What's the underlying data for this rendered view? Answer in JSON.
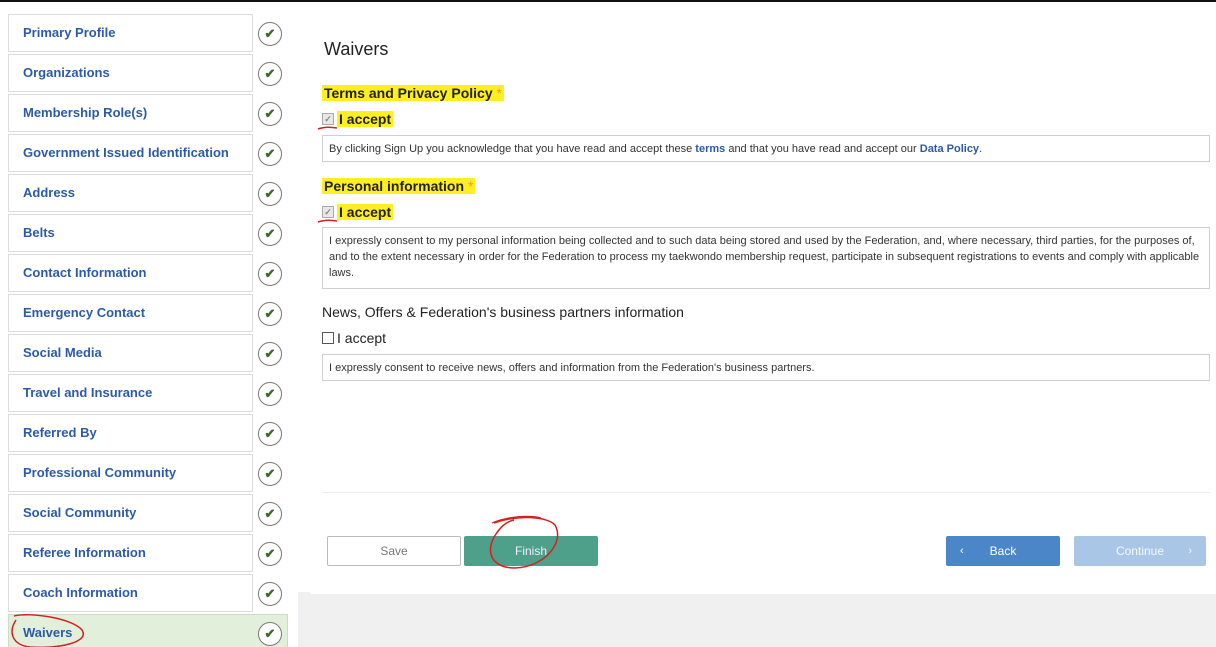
{
  "sidebar": {
    "items": [
      {
        "label": "Primary Profile"
      },
      {
        "label": "Organizations"
      },
      {
        "label": "Membership Role(s)"
      },
      {
        "label": "Government Issued Identification"
      },
      {
        "label": "Address"
      },
      {
        "label": "Belts"
      },
      {
        "label": "Contact Information"
      },
      {
        "label": "Emergency Contact"
      },
      {
        "label": "Social Media"
      },
      {
        "label": "Travel and Insurance"
      },
      {
        "label": "Referred By"
      },
      {
        "label": "Professional Community"
      },
      {
        "label": "Social Community"
      },
      {
        "label": "Referee Information"
      },
      {
        "label": "Coach Information"
      },
      {
        "label": "Waivers"
      }
    ],
    "check_glyph": "✔",
    "active_item": "Waivers"
  },
  "main": {
    "title": "Waivers",
    "sections": [
      {
        "title": "Terms and Privacy Policy",
        "required_mark": "*",
        "accept_label": "I accept",
        "checked": true,
        "text_before": "By clicking Sign Up you acknowledge that you have read and accept these ",
        "link1": "terms",
        "text_middle": " and that you have read and accept our ",
        "link2": "Data Policy",
        "text_after": "."
      },
      {
        "title": "Personal information",
        "required_mark": "*",
        "accept_label": "I accept",
        "checked": true,
        "text": "I expressly consent to my personal information being collected and to such data being stored and used by the Federation, and, where necessary, third parties, for the purposes of, and to the extent necessary in order for the Federation to process my taekwondo membership request, participate in subsequent registrations to events and comply with applicable laws."
      },
      {
        "title": "News, Offers & Federation's business partners information",
        "accept_label": "I accept",
        "checked": false,
        "text": "I expressly consent to receive news, offers and information from the Federation's business partners."
      }
    ],
    "buttons": {
      "save": "Save",
      "finish": "Finish",
      "back": "Back",
      "continue": "Continue",
      "back_chevron": "‹",
      "continue_chevron": "›"
    }
  },
  "colors": {
    "link": "#2b5ba8",
    "highlight": "#ffee22",
    "finish": "#4ea08a",
    "back": "#4a86c8",
    "continue_disabled": "#a9c6e6",
    "active_sidebar": "#e2efdb",
    "annotation": "#d42020"
  }
}
